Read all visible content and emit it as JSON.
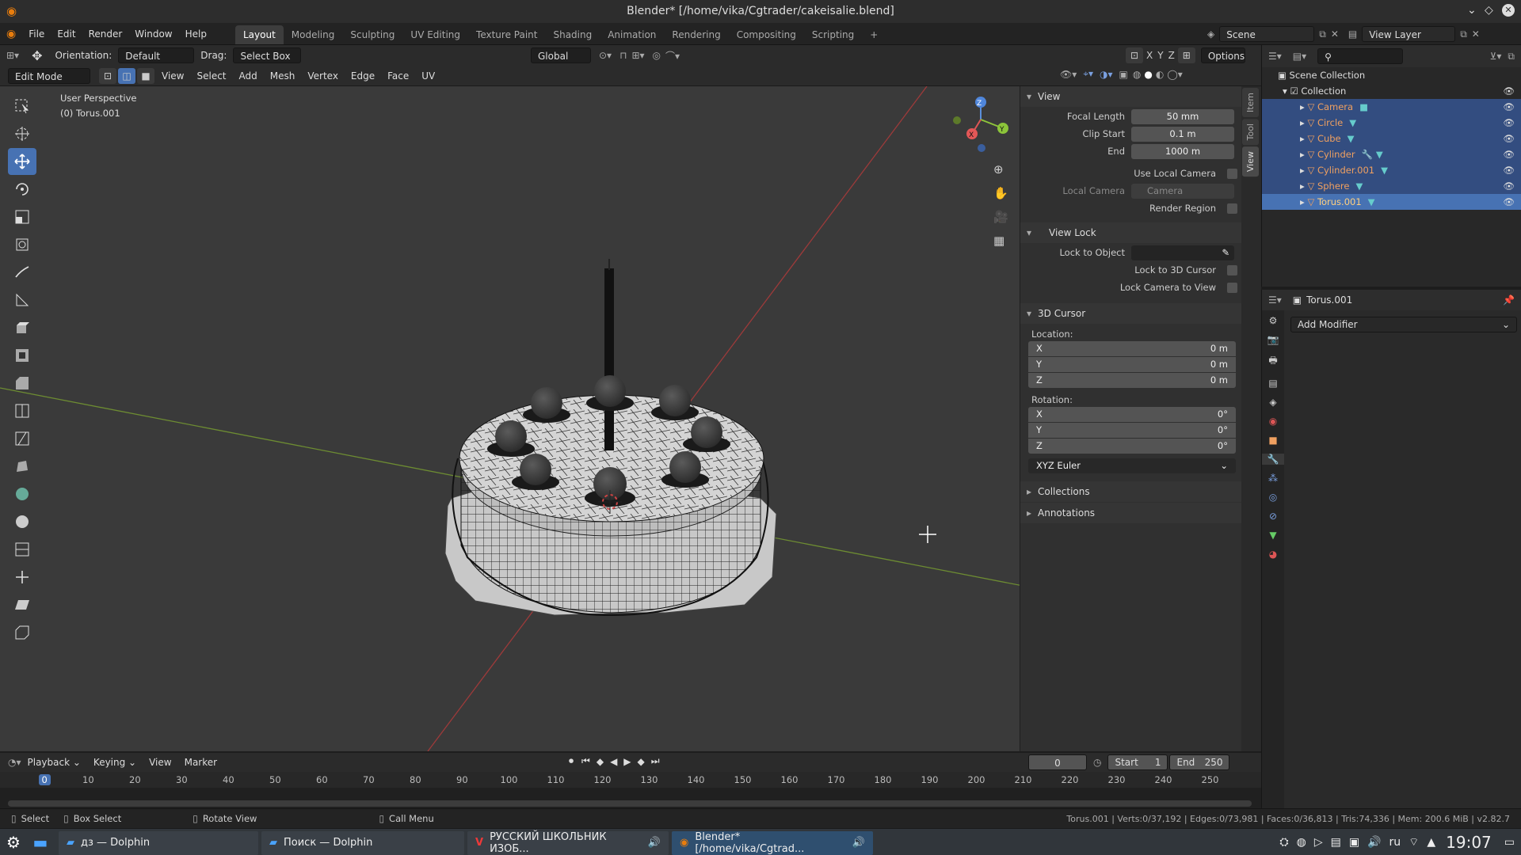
{
  "title": "Blender* [/home/vika/Cgtrader/cakeisalie.blend]",
  "menus": [
    "File",
    "Edit",
    "Render",
    "Window",
    "Help"
  ],
  "workspaces": [
    "Layout",
    "Modeling",
    "Sculpting",
    "UV Editing",
    "Texture Paint",
    "Shading",
    "Animation",
    "Rendering",
    "Compositing",
    "Scripting"
  ],
  "scene": "Scene",
  "view_layer": "View Layer",
  "header1": {
    "orientation_label": "Orientation:",
    "orientation": "Default",
    "drag_label": "Drag:",
    "drag": "Select Box",
    "transform": "Global",
    "options": "Options"
  },
  "header2": {
    "mode": "Edit Mode",
    "menus": [
      "View",
      "Select",
      "Add",
      "Mesh",
      "Vertex",
      "Edge",
      "Face",
      "UV"
    ]
  },
  "viewport": {
    "perspective": "User Perspective",
    "object": "(0) Torus.001"
  },
  "npanel": {
    "view_title": "View",
    "focal_label": "Focal Length",
    "focal": "50 mm",
    "clipstart_label": "Clip Start",
    "clipstart": "0.1 m",
    "end_label": "End",
    "end": "1000 m",
    "use_local_camera": "Use Local Camera",
    "local_camera_label": "Local Camera",
    "local_camera": "Camera",
    "render_region": "Render Region",
    "viewlock_title": "View Lock",
    "lock_obj": "Lock to Object",
    "lock_cursor": "Lock to 3D Cursor",
    "lock_camera": "Lock Camera to View",
    "cursor_title": "3D Cursor",
    "location": "Location:",
    "rotation": "Rotation:",
    "loc": [
      [
        "X",
        "0 m"
      ],
      [
        "Y",
        "0 m"
      ],
      [
        "Z",
        "0 m"
      ]
    ],
    "rot": [
      [
        "X",
        "0°"
      ],
      [
        "Y",
        "0°"
      ],
      [
        "Z",
        "0°"
      ]
    ],
    "euler": "XYZ Euler",
    "collections": "Collections",
    "annotations": "Annotations",
    "tabs": [
      "Item",
      "Tool",
      "View"
    ]
  },
  "outliner": {
    "scene_collection": "Scene Collection",
    "collection": "Collection",
    "objects": [
      "Camera",
      "Circle",
      "Cube",
      "Cylinder",
      "Cylinder.001",
      "Sphere",
      "Torus.001"
    ]
  },
  "properties": {
    "object": "Torus.001",
    "add_modifier": "Add Modifier"
  },
  "timeline": {
    "menus": [
      "Playback",
      "Keying",
      "View",
      "Marker"
    ],
    "frame": "0",
    "start_label": "Start",
    "start": "1",
    "end_label": "End",
    "end": "250",
    "ticks": [
      "0",
      "10",
      "20",
      "30",
      "40",
      "50",
      "60",
      "70",
      "80",
      "90",
      "100",
      "110",
      "120",
      "130",
      "140",
      "150",
      "160",
      "170",
      "180",
      "190",
      "200",
      "210",
      "220",
      "230",
      "240",
      "250"
    ]
  },
  "status": {
    "select": "Select",
    "box_select": "Box Select",
    "rotate": "Rotate View",
    "call_menu": "Call Menu",
    "stats": "Torus.001 | Verts:0/37,192 | Edges:0/73,981 | Faces:0/36,813 | Tris:74,336 | Mem: 200.6 MiB | v2.82.7"
  },
  "taskbar": {
    "tasks": [
      "дз — Dolphin",
      "Поиск — Dolphin",
      "РУССКИЙ ШКОЛЬНИК ИЗОБ...",
      "Blender* [/home/vika/Cgtrad..."
    ],
    "lang": "ru",
    "time": "19:07"
  }
}
